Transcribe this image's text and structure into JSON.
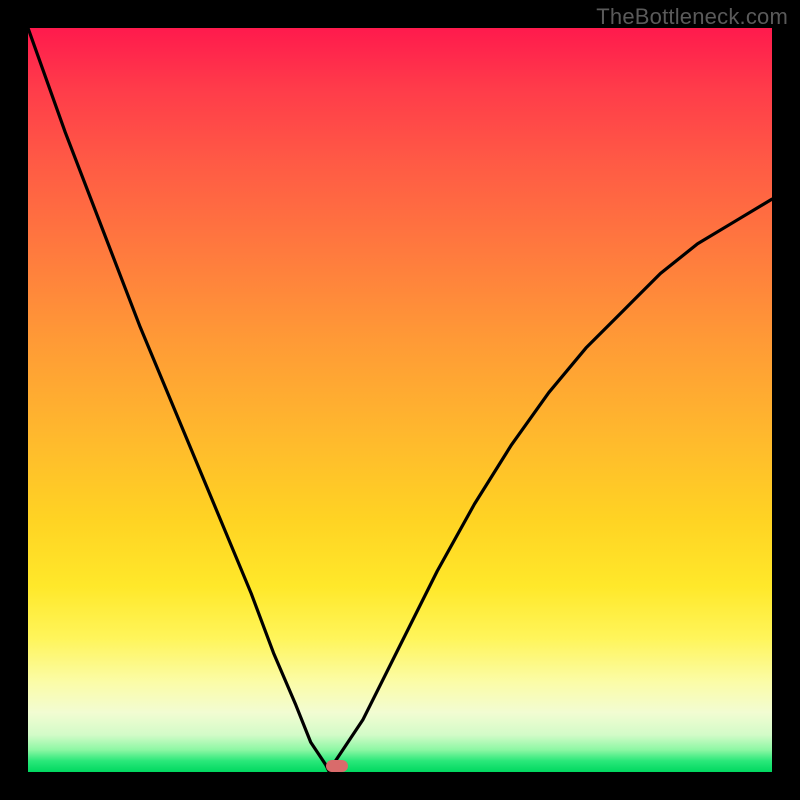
{
  "watermark": "TheBottleneck.com",
  "chart_data": {
    "type": "line",
    "title": "",
    "xlabel": "",
    "ylabel": "",
    "xlim": [
      0,
      1
    ],
    "ylim": [
      0,
      1
    ],
    "x": [
      0.0,
      0.05,
      0.1,
      0.15,
      0.2,
      0.25,
      0.3,
      0.33,
      0.36,
      0.38,
      0.4,
      0.405,
      0.41,
      0.45,
      0.5,
      0.55,
      0.6,
      0.65,
      0.7,
      0.75,
      0.8,
      0.85,
      0.9,
      0.95,
      1.0
    ],
    "values": [
      1.0,
      0.86,
      0.73,
      0.6,
      0.48,
      0.36,
      0.24,
      0.16,
      0.09,
      0.04,
      0.01,
      0.0,
      0.01,
      0.07,
      0.17,
      0.27,
      0.36,
      0.44,
      0.51,
      0.57,
      0.62,
      0.67,
      0.71,
      0.74,
      0.77
    ],
    "note": "x,y normalized to plot area [0,1]; y=0 is the bottom (minimum bottleneck)",
    "marker_x": 0.415,
    "marker_y": 0.0
  },
  "colors": {
    "curve_stroke": "#000000",
    "background_frame": "#000000",
    "marker_fill": "#d96b6b",
    "gradient_top": "#ff1a4d",
    "gradient_bottom": "#00d860"
  }
}
